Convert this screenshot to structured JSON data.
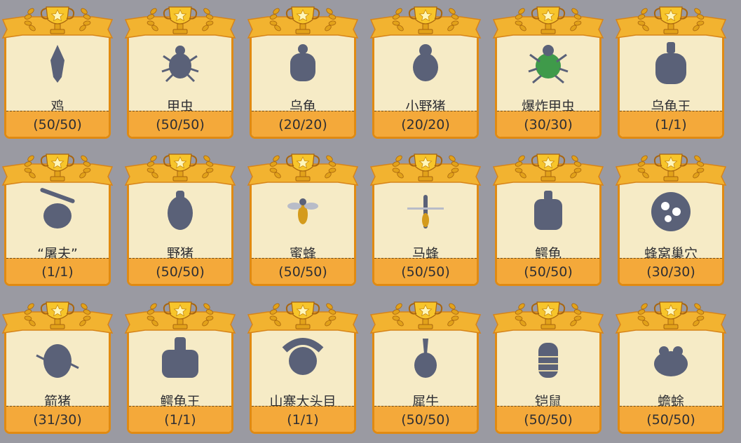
{
  "colors": {
    "background": "#9a9aa2",
    "card": "#f6ebc6",
    "border": "#e08a12",
    "footer": "#f4a93a",
    "banner": "#f2b330",
    "gold": "#f7c52b",
    "creature": "#5a6178"
  },
  "achievements": [
    {
      "name": "鸡",
      "progress": "(50/50)",
      "icon": "chicken-icon"
    },
    {
      "name": "甲虫",
      "progress": "(50/50)",
      "icon": "beetle-icon"
    },
    {
      "name": "乌龟",
      "progress": "(20/20)",
      "icon": "turtle-icon"
    },
    {
      "name": "小野猪",
      "progress": "(20/20)",
      "icon": "small-boar-icon"
    },
    {
      "name": "爆炸甲虫",
      "progress": "(30/30)",
      "icon": "explosive-beetle-icon"
    },
    {
      "name": "乌龟王",
      "progress": "(1/1)",
      "icon": "turtle-king-icon"
    },
    {
      "name": "“屠夫”",
      "progress": "(1/1)",
      "icon": "butcher-icon"
    },
    {
      "name": "野猪",
      "progress": "(50/50)",
      "icon": "boar-icon"
    },
    {
      "name": "蜜蜂",
      "progress": "(50/50)",
      "icon": "bee-icon"
    },
    {
      "name": "马蜂",
      "progress": "(50/50)",
      "icon": "wasp-icon"
    },
    {
      "name": "鳄龟",
      "progress": "(50/50)",
      "icon": "snapping-turtle-icon"
    },
    {
      "name": "蜂窝巢穴",
      "progress": "(30/30)",
      "icon": "hive-icon"
    },
    {
      "name": "箭猪",
      "progress": "(31/30)",
      "icon": "porcupine-icon"
    },
    {
      "name": "鳄龟王",
      "progress": "(1/1)",
      "icon": "snapping-turtle-king-icon"
    },
    {
      "name": "山寨大头目",
      "progress": "(1/1)",
      "icon": "bandit-chief-icon"
    },
    {
      "name": "犀牛",
      "progress": "(50/50)",
      "icon": "rhino-icon"
    },
    {
      "name": "铠鼠",
      "progress": "(50/50)",
      "icon": "armadillo-icon"
    },
    {
      "name": "蟾蜍",
      "progress": "(50/50)",
      "icon": "toad-icon"
    }
  ]
}
